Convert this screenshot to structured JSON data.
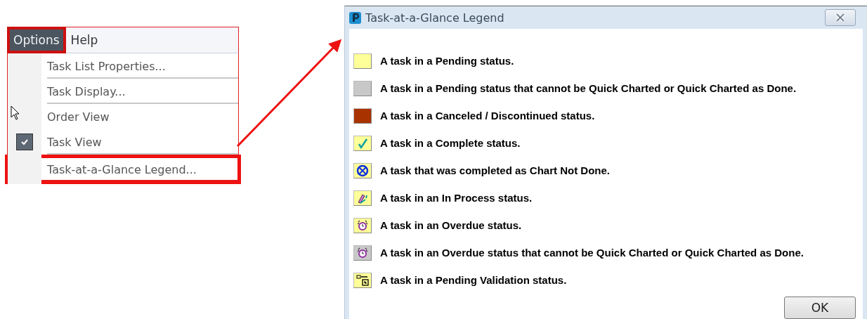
{
  "menu_bar": [
    {
      "label": "Options",
      "selected": true,
      "highlighted": true
    },
    {
      "label": "Help",
      "selected": false,
      "highlighted": false
    }
  ],
  "menu": {
    "highlighted": true,
    "items": [
      {
        "label": "Task List Properties...",
        "checked": false,
        "separator_after": true,
        "highlighted": false
      },
      {
        "label": "Task Display...",
        "checked": false,
        "separator_after": true,
        "highlighted": false
      },
      {
        "label": "Order View",
        "checked": false,
        "separator_after": false,
        "highlighted": false
      },
      {
        "label": "Task View",
        "checked": true,
        "separator_after": true,
        "highlighted": false
      },
      {
        "label": "Task-at-a-Glance Legend...",
        "checked": false,
        "separator_after": false,
        "highlighted": true
      }
    ]
  },
  "dialog": {
    "title": "Task-at-a-Glance Legend",
    "legend": [
      {
        "kind": "swatch",
        "color": "#ffff99",
        "text": "A task in a Pending status."
      },
      {
        "kind": "swatch",
        "color": "#c8c8c8",
        "text": "A task in a Pending status that cannot be Quick Charted or Quick Charted as Done."
      },
      {
        "kind": "swatch",
        "color": "#a83200",
        "text": "A task in a Canceled / Discontinued status."
      },
      {
        "kind": "check",
        "text": "A task in a Complete status."
      },
      {
        "kind": "not-done",
        "text": "A task that was completed as Chart Not Done."
      },
      {
        "kind": "in-process",
        "text": "A task in an In Process status."
      },
      {
        "kind": "overdue",
        "text": "A task in an Overdue status."
      },
      {
        "kind": "overdue-grey",
        "text": "A task in an Overdue status that cannot be Quick Charted or Quick Charted as Done."
      },
      {
        "kind": "validation",
        "text": "A task in a Pending Validation status."
      }
    ],
    "ok_button": "OK"
  }
}
